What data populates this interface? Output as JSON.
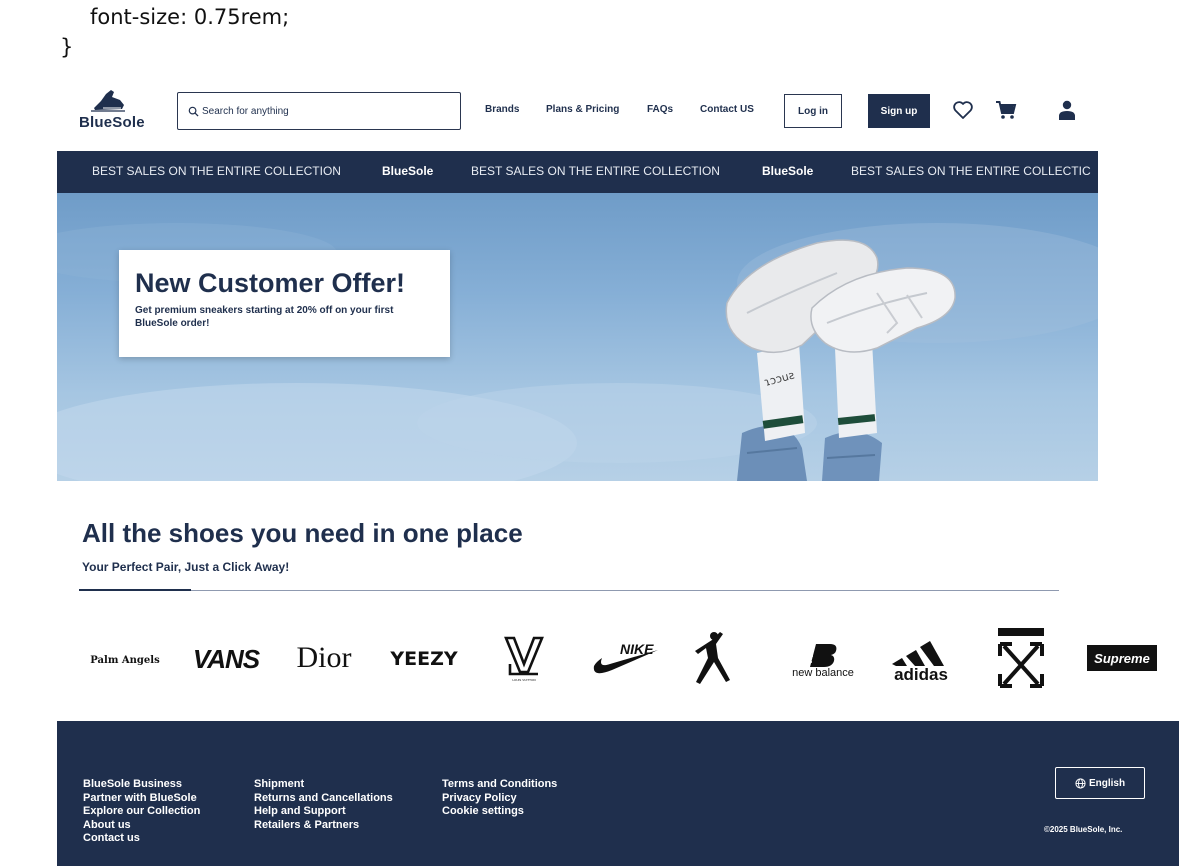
{
  "code_snippet": {
    "line1": "font-size: 0.75rem;",
    "line2": "}"
  },
  "header": {
    "logo_text": "BlueSole",
    "search_placeholder": "Search for anything",
    "nav": [
      "Brands",
      "Plans & Pricing",
      "FAQs",
      "Contact US"
    ],
    "login_label": "Log in",
    "signup_label": "Sign up",
    "icons": [
      "heart-icon",
      "cart-icon",
      "user-icon"
    ]
  },
  "marquee": {
    "promo": "BEST SALES ON THE ENTIRE COLLECTION",
    "brand": "BlueSole",
    "promo_cut": "BEST SALES ON THE ENTIRE COLLECTIC"
  },
  "hero": {
    "offer_title": "New Customer Offer!",
    "offer_text": "Get premium sneakers starting at 20% off on your first BlueSole order!",
    "sock_text": "ɿɔɔuƨ"
  },
  "section": {
    "title": "All the shoes you need in one place",
    "subtitle": "Your Perfect Pair, Just a Click Away!"
  },
  "brands": {
    "palm_angels": "Palm Angels",
    "vans": "VANS",
    "dior": "Dior",
    "yeezy": "YEEZY",
    "lv_sub": "LOUIS VUITTON",
    "nike": "NIKE",
    "nb": "new balance",
    "adidas": "adidas",
    "supreme": "Supreme"
  },
  "footer": {
    "col1": [
      "BlueSole Business",
      "Partner with BlueSole",
      "Explore our Collection",
      "About us",
      "Contact us"
    ],
    "col2": [
      "Shipment",
      "Returns and Cancellations",
      "Help and Support",
      "Retailers & Partners"
    ],
    "col3": [
      "Terms and Conditions",
      "Privacy Policy",
      "Cookie settings"
    ],
    "language": "English",
    "copyright": "©2025 BlueSole, Inc."
  },
  "colors": {
    "navy": "#1f2f4d",
    "white": "#ffffff",
    "sky": "#86afd6"
  }
}
